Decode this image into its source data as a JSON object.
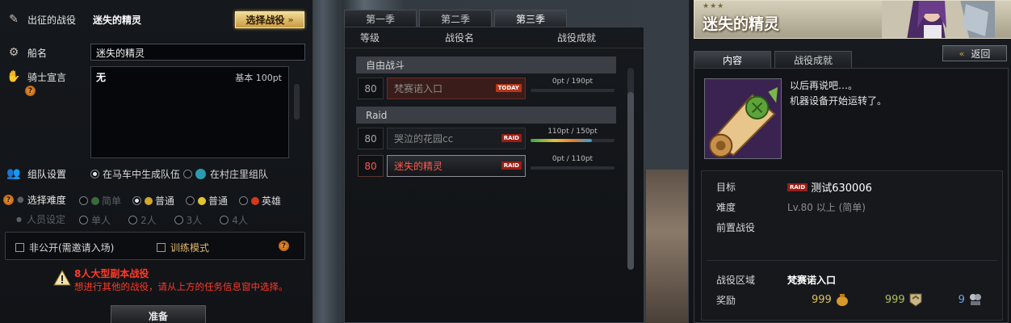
{
  "left": {
    "campaign_label": "出征的战役",
    "campaign_value": "迷失的精灵",
    "choose_button": "选择战役",
    "ship_label": "船名",
    "ship_value": "迷失的精灵",
    "declare_label": "骑士宣言",
    "declare_value": "无",
    "declare_points": "基本 100pt",
    "party_label": "组队设置",
    "party_opt1": "在马车中生成队伍",
    "party_opt2": "在村庄里组队",
    "difficulty_label": "选择难度",
    "diff_easy": "简单",
    "diff_normal1": "普通",
    "diff_normal2": "普通",
    "diff_hero": "英雄",
    "members_label": "人员设定",
    "m1": "单人",
    "m2": "2人",
    "m3": "3人",
    "m4": "4人",
    "private_label": "非公开(需邀请入场)",
    "training_label": "训练模式",
    "warn_title": "8人大型副本战役",
    "warn_text": "想进行其他的战役，请从上方的任务信息窗中选择。",
    "ready_button": "准备"
  },
  "middle": {
    "tabs": [
      "第一季",
      "第二季",
      "第三季"
    ],
    "head_level": "等级",
    "head_name": "战役名",
    "head_achieve": "战役成就",
    "section_free": "自由战斗",
    "section_raid": "Raid",
    "campaigns": [
      {
        "level": "80",
        "name": "梵赛诺入口",
        "tag": "TODAY",
        "points": "0pt / 190pt",
        "fill": 0
      },
      {
        "level": "80",
        "name": "哭泣的花园cc",
        "tag": "RAID",
        "points": "110pt / 150pt",
        "fill": 0.733
      },
      {
        "level": "80",
        "name": "迷失的精灵",
        "tag": "RAID",
        "points": "0pt / 110pt",
        "fill": 0
      }
    ]
  },
  "right": {
    "stars": "★★★",
    "title": "迷失的精灵",
    "tab_content": "内容",
    "tab_achieve": "战役成就",
    "back_button": "返回",
    "desc_line1": "以后再说吧…。",
    "desc_line2": "机器设备开始运转了。",
    "target_label": "目标",
    "target_tag": "RAID",
    "target_value": "测试630006",
    "difficulty_label": "难度",
    "difficulty_value": "Lv.80 以上 (简单)",
    "prereq_label": "前置战役",
    "area_label": "战役区域",
    "area_value": "梵赛诺入口",
    "reward_label": "奖励",
    "reward_gold": "999",
    "reward_exp": "999",
    "reward_ap": "9"
  },
  "colors": {
    "accent_gold": "#c89b3f",
    "raid_red": "#9a1d16",
    "warn_red": "#ff3a2a",
    "selected_text": "#ff5a4a"
  }
}
